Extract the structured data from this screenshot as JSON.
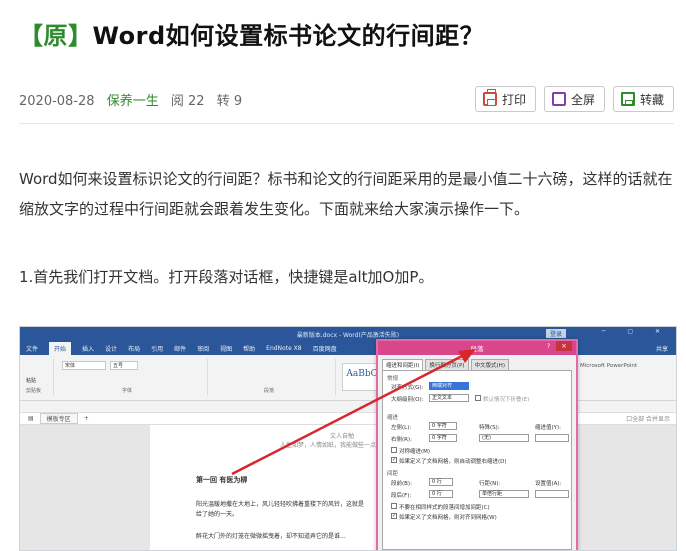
{
  "article": {
    "tag": "【原】",
    "title": "Word如何设置标书论文的行间距？",
    "date": "2020-08-28",
    "author": "保养一生",
    "reads": "阅 22",
    "reposts": "转 9"
  },
  "actions": {
    "print": "打印",
    "fullscreen": "全屏",
    "save": "转藏"
  },
  "content": {
    "para1": "Word如何来设置标识论文的行间距？标书和论文的行间距采用的是最小值二十六磅，这样的话就在缩放文字的过程中行间距就会跟着发生变化。下面就来给大家演示操作一下。",
    "para2": "1.首先我们打开文档。打开段落对话框，快捷键是alt加O加P。"
  },
  "word_screenshot": {
    "window_title": "最新版本.docx  -  Word(产品激活失败)",
    "login": "登录",
    "tabs": [
      "文件",
      "开始",
      "插入",
      "设计",
      "布局",
      "引用",
      "邮件",
      "审阅",
      "视图",
      "帮助",
      "EndNote X8",
      "百度网盘"
    ],
    "share": "共享",
    "ribbon": {
      "font_name": "宋体",
      "font_size": "五号",
      "paste": "粘贴",
      "clipboard": "剪贴板",
      "font_group": "字体",
      "paragraph_group": "段落",
      "style_preview": "AaBbC",
      "ppt": "Microsoft PowerPoint"
    },
    "nav": {
      "template": "模板专区",
      "right": "口全部 合并显示"
    },
    "page": {
      "heading_small": "文人自勉",
      "line1": "人生如梦，人情如纸，我能做些一点灵药，我能说什么...",
      "chapter": "第一回  有医为柳",
      "line2": "阳光温暖地撒在大地上，风儿轻轻吹拂着重楼下的风铃，这就是",
      "line3": "给了她的一天。",
      "line4": "醉花大门外的灯笼在微微摇曳着，却不知道弄它的是谁..."
    },
    "dialog": {
      "title": "段落",
      "help": "?",
      "close": "×",
      "tabs": [
        "缩进和间距(I)",
        "换行和分页(P)",
        "中文版式(H)"
      ],
      "general": "常规",
      "alignment_label": "对齐方式(G):",
      "alignment_value": "两端对齐",
      "outline_label": "大纲级别(O):",
      "outline_value": "正文文本",
      "collapsed": "默认情况下折叠(E)",
      "indent": "缩进",
      "left_label": "左侧(L):",
      "left_value": "0 字符",
      "right_label": "右侧(R):",
      "right_value": "0 字符",
      "special_label": "特殊(S):",
      "special_value": "(无)",
      "indent_value_label": "缩进值(Y):",
      "mirror": "对称缩进(M)",
      "auto_adjust": "如果定义了文档网格，则自动调整右缩进(D)",
      "spacing": "间距",
      "before_label": "段前(B):",
      "before_value": "0 行",
      "after_label": "段后(F):",
      "after_value": "0 行",
      "line_label": "行距(N):",
      "line_value": "单倍行距",
      "setting_label": "设置值(A):",
      "no_space": "不要在相同样式的段落间增加间距(C)",
      "snap_grid": "如果定义了文档网格，则对齐到网格(W)"
    }
  }
}
